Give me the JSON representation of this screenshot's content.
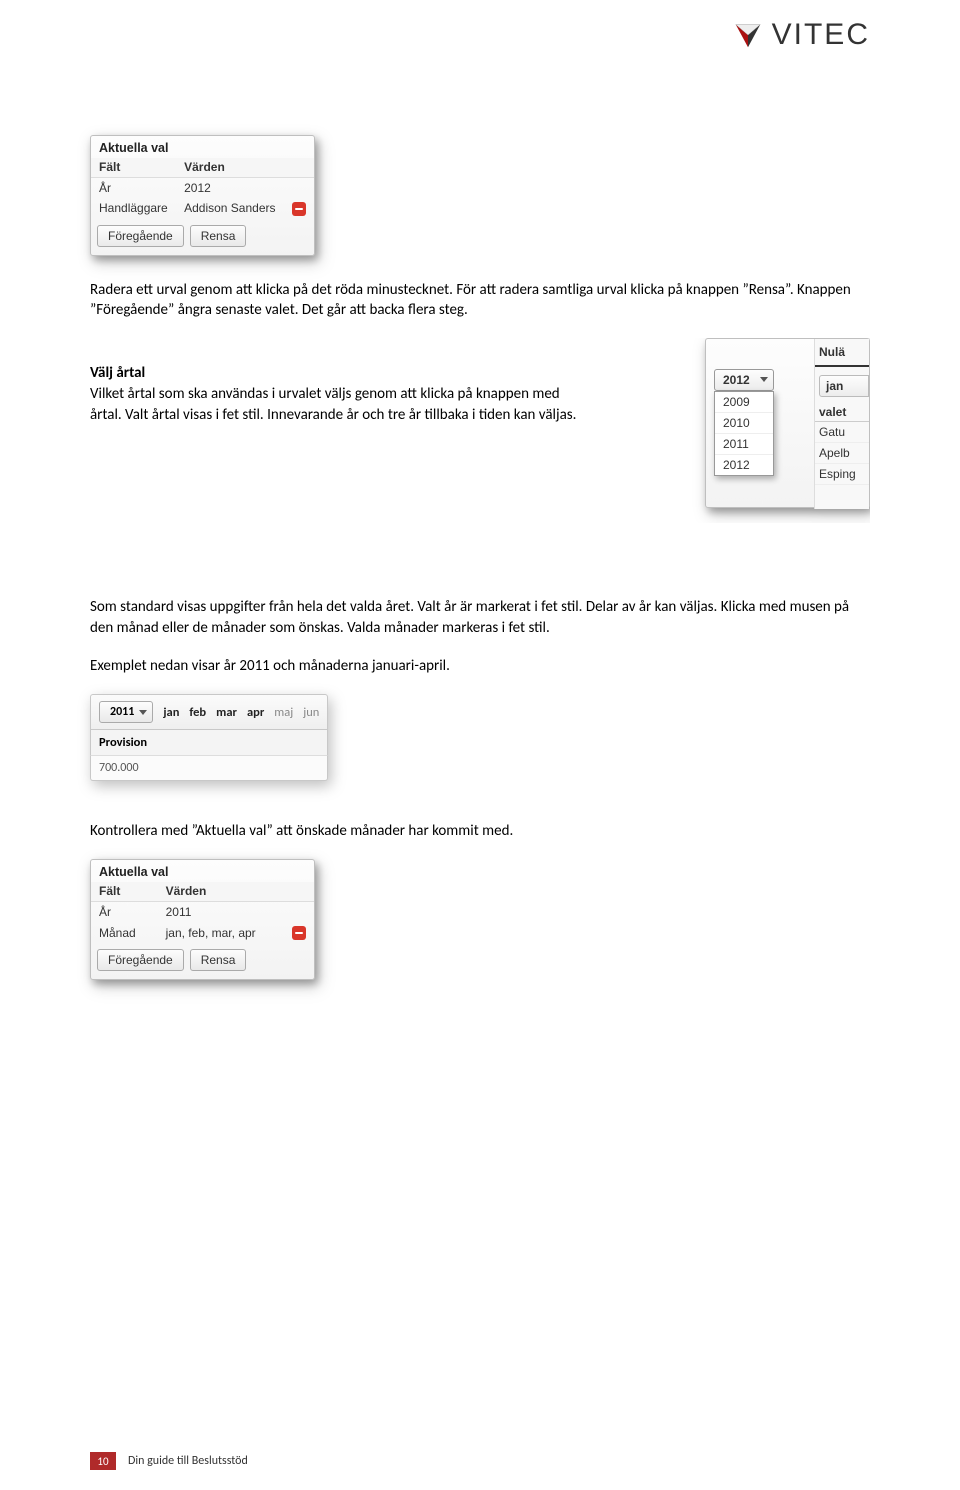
{
  "brand": {
    "name": "VITEC"
  },
  "figure1": {
    "title": "Aktuella val",
    "col_field": "Fält",
    "col_values": "Värden",
    "rows": [
      {
        "field": "År",
        "value": "2012",
        "removable": false
      },
      {
        "field": "Handläggare",
        "value": "Addison Sanders",
        "removable": true
      }
    ],
    "btn_prev": "Föregående",
    "btn_clear": "Rensa"
  },
  "para1": "Radera ett urval genom att klicka på det röda minustecknet. För att radera samtliga urval klicka på knappen ”Rensa”. Knappen ”Föregående” ångra senaste valet. Det går att backa flera steg.",
  "section_year_head": "Välj årtal",
  "section_year_body": "Vilket årtal som ska användas i urvalet väljs genom att klicka på knappen med årtal. Valt årtal visas i fet stil. Innevarande år och tre år tillbaka i tiden kan väljas.",
  "figure2": {
    "selected": "2012",
    "options": [
      "2009",
      "2010",
      "2011",
      "2012"
    ],
    "right_header": "Nulä",
    "right_tab": "jan",
    "right_sub": "valet",
    "right_rows": [
      "Gatu",
      "Apelb",
      "Esping"
    ]
  },
  "para2": "Som standard visas uppgifter från hela det valda året. Valt år är markerat i fet stil. Delar av år kan väljas. Klicka med musen på den månad eller de månader som önskas. Valda månader markeras i fet stil.",
  "para3": "Exemplet nedan visar år 2011 och månaderna januari-april.",
  "figure3": {
    "year": "2011",
    "months": [
      {
        "label": "jan",
        "selected": true
      },
      {
        "label": "feb",
        "selected": true
      },
      {
        "label": "mar",
        "selected": true
      },
      {
        "label": "apr",
        "selected": true
      },
      {
        "label": "maj",
        "selected": false
      },
      {
        "label": "jun",
        "selected": false
      }
    ],
    "prov_label": "Provision",
    "prov_value": "700.000"
  },
  "para4": "Kontrollera med ”Aktuella val” att önskade månader har kommit med.",
  "figure4": {
    "title": "Aktuella val",
    "col_field": "Fält",
    "col_values": "Värden",
    "rows": [
      {
        "field": "År",
        "value": "2011",
        "removable": false
      },
      {
        "field": "Månad",
        "value": "jan, feb, mar, apr",
        "removable": true
      }
    ],
    "btn_prev": "Föregående",
    "btn_clear": "Rensa"
  },
  "footer": {
    "page": "10",
    "title": "Din guide till Beslutsstöd"
  }
}
